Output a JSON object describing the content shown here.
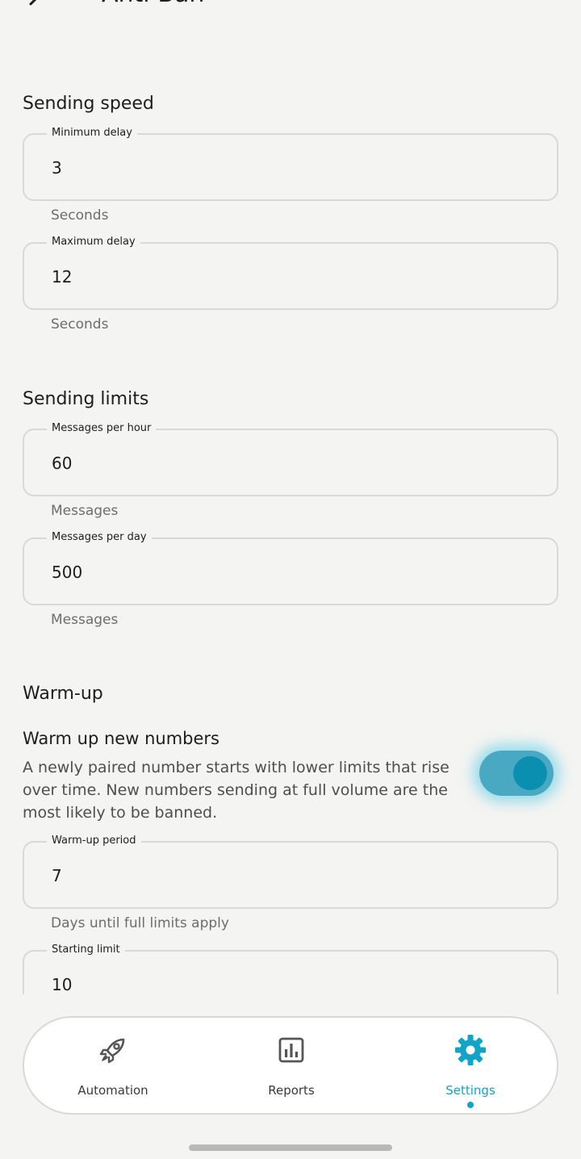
{
  "header": {
    "title": "Anti-Ban"
  },
  "sections": {
    "speed": {
      "title": "Sending speed",
      "min_delay": {
        "label": "Minimum delay",
        "value": "3",
        "helper": "Seconds"
      },
      "max_delay": {
        "label": "Maximum delay",
        "value": "12",
        "helper": "Seconds"
      }
    },
    "limits": {
      "title": "Sending limits",
      "per_hour": {
        "label": "Messages per hour",
        "value": "60",
        "helper": "Messages"
      },
      "per_day": {
        "label": "Messages per day",
        "value": "500",
        "helper": "Messages"
      }
    },
    "warmup": {
      "title": "Warm-up",
      "toggle_title": "Warm up new numbers",
      "toggle_desc": "A newly paired number starts with lower limits that rise over time. New numbers sending at full volume are the most likely to be banned.",
      "toggle_on": true,
      "period": {
        "label": "Warm-up period",
        "value": "7",
        "helper": "Days until full limits apply"
      },
      "starting": {
        "label": "Starting limit",
        "value": "10"
      }
    }
  },
  "nav": {
    "items": [
      {
        "label": "Automation",
        "icon": "rocket-icon",
        "active": false
      },
      {
        "label": "Reports",
        "icon": "chart-icon",
        "active": false
      },
      {
        "label": "Settings",
        "icon": "gear-icon",
        "active": true
      }
    ]
  },
  "colors": {
    "accent": "#12a4c7",
    "switch_track": "#4aa9c2",
    "background": "#f4f4f2"
  }
}
